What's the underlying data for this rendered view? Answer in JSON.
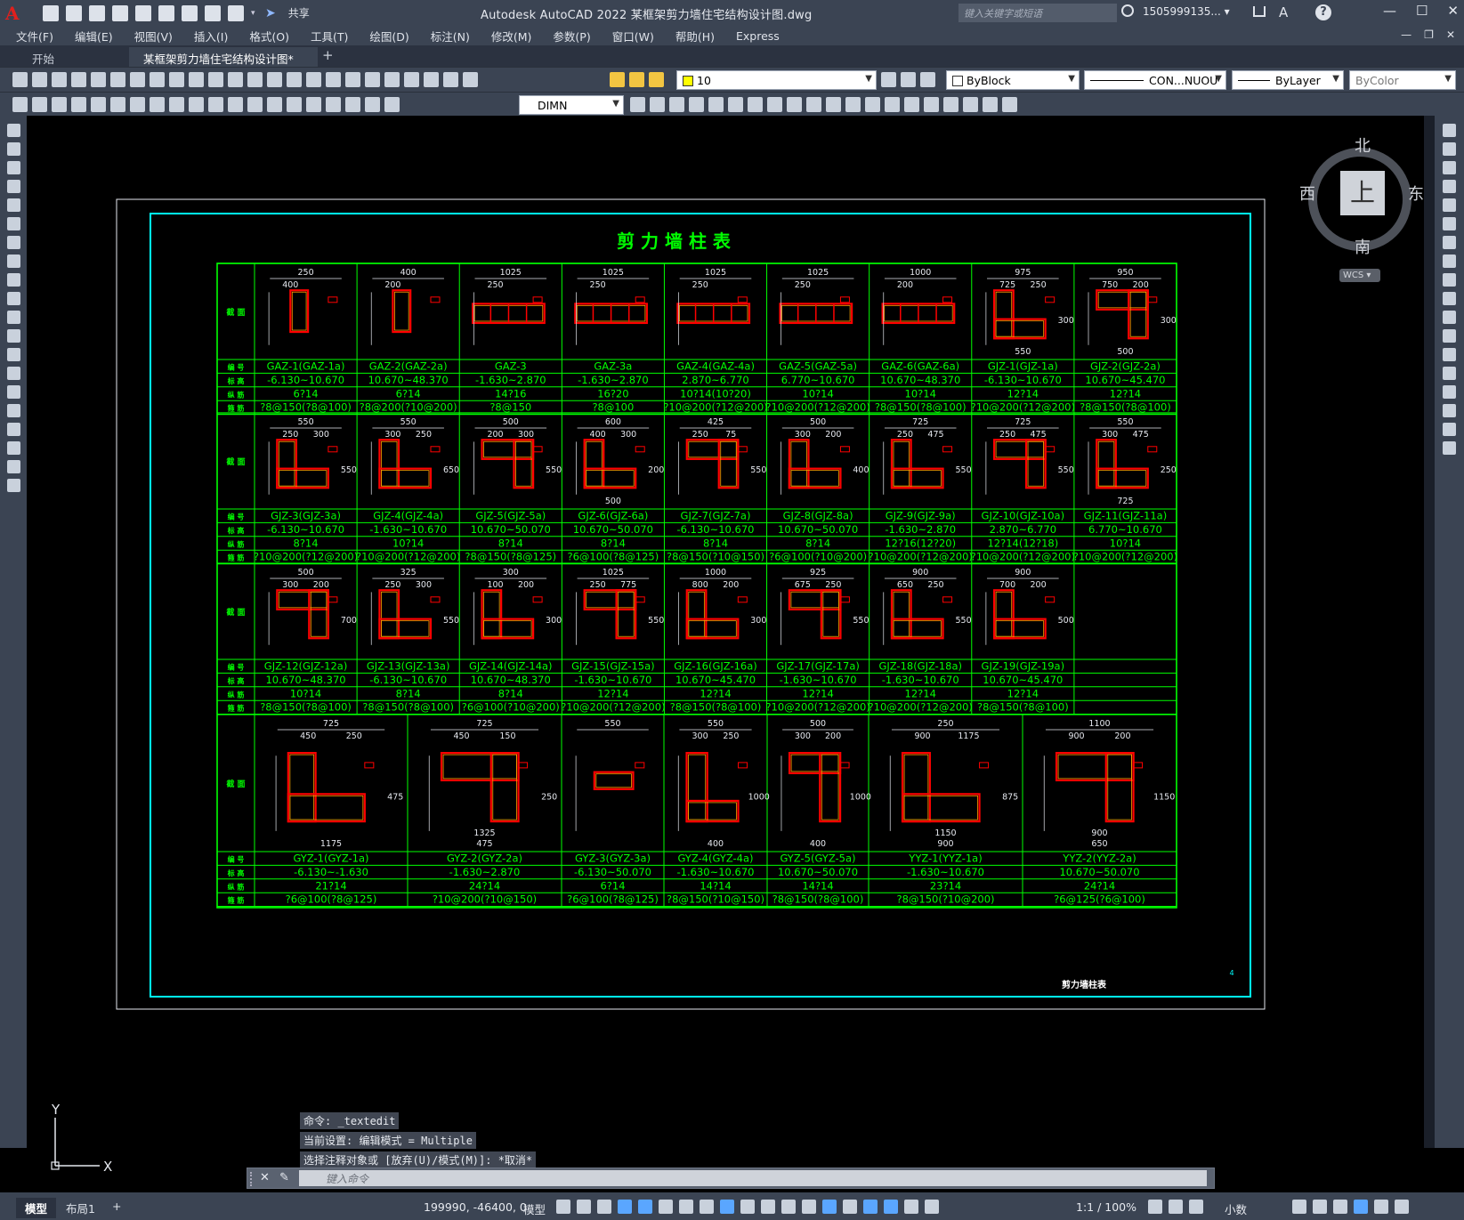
{
  "app": {
    "logo": "A",
    "window_title": "Autodesk AutoCAD 2022    某框架剪力墙住宅结构设计图.dwg",
    "share_label": "共享",
    "search_placeholder": "键入关键字或短语",
    "user": "1505999135... ▾",
    "help": "?"
  },
  "menu": {
    "items": [
      "文件(F)",
      "编辑(E)",
      "视图(V)",
      "插入(I)",
      "格式(O)",
      "工具(T)",
      "绘图(D)",
      "标注(N)",
      "修改(M)",
      "参数(P)",
      "窗口(W)",
      "帮助(H)",
      "Express"
    ]
  },
  "tabs": {
    "start": "开始",
    "drawing": "某框架剪力墙住宅结构设计图*",
    "close": "×"
  },
  "toolbar": {
    "layer_value": "10",
    "color_value": "ByBlock",
    "linetype_value": "CON...NUOU",
    "lineweight_value": "ByLayer",
    "plotstyle_value": "ByColor",
    "dimstyle_value": "DIMN"
  },
  "viewcube": {
    "north": "北",
    "south": "南",
    "west": "西",
    "east": "东",
    "top": "上",
    "wcs": "WCS ▾"
  },
  "ucs": {
    "x": "X",
    "y": "Y"
  },
  "drawing": {
    "title": "剪 力 墙 柱 表",
    "footer_title": "剪力墙柱表",
    "page_no": "4",
    "row_labels": {
      "section": "截 面",
      "id": "编 号",
      "elev": "标 高",
      "rebar": "纵 筋",
      "hoop": "箍 筋",
      "hoop2": "箍 筋"
    },
    "block1": {
      "ids": [
        "GAZ-1(GAZ-1a)",
        "GAZ-2(GAZ-2a)",
        "GAZ-3",
        "GAZ-3a",
        "GAZ-4(GAZ-4a)",
        "GAZ-5(GAZ-5a)",
        "GAZ-6(GAZ-6a)",
        "GJZ-1(GJZ-1a)",
        "GJZ-2(GJZ-2a)"
      ],
      "elevs": [
        "-6.130~10.670",
        "10.670~48.370",
        "-1.630~2.870",
        "-1.630~2.870",
        "2.870~6.770",
        "6.770~10.670",
        "10.670~48.370",
        "-6.130~10.670",
        "10.670~45.470"
      ],
      "rebars": [
        "6?14",
        "6?14",
        "14?16",
        "16?20",
        "10?14(10?20)",
        "10?14",
        "10?14",
        "12?14",
        "12?14"
      ],
      "hoops": [
        "?8@150(?8@100)",
        "?8@200(?10@200)",
        "?8@150",
        "?8@100",
        "?10@200(?12@200)",
        "?10@200(?12@200)",
        "?8@150(?8@100)",
        "?10@200(?12@200)",
        "?8@150(?8@100)"
      ],
      "dims": [
        [
          "250",
          "400"
        ],
        [
          "400",
          "200"
        ],
        [
          "1025",
          "250"
        ],
        [
          "1025",
          "250"
        ],
        [
          "1025",
          "250"
        ],
        [
          "1025",
          "250"
        ],
        [
          "1000",
          "200"
        ],
        [
          "975",
          "725",
          "250",
          "300",
          "550"
        ],
        [
          "950",
          "750",
          "200",
          "300",
          "500"
        ]
      ]
    },
    "block2": {
      "ids": [
        "GJZ-3(GJZ-3a)",
        "GJZ-4(GJZ-4a)",
        "GJZ-5(GJZ-5a)",
        "GJZ-6(GJZ-6a)",
        "GJZ-7(GJZ-7a)",
        "GJZ-8(GJZ-8a)",
        "GJZ-9(GJZ-9a)",
        "GJZ-10(GJZ-10a)",
        "GJZ-11(GJZ-11a)"
      ],
      "elevs": [
        "-6.130~10.670",
        "-1.630~10.670",
        "10.670~50.070",
        "10.670~50.070",
        "-6.130~10.670",
        "10.670~50.070",
        "-1.630~2.870",
        "2.870~6.770",
        "6.770~10.670"
      ],
      "rebars": [
        "8?14",
        "10?14",
        "8?14",
        "8?14",
        "8?14",
        "8?14",
        "12?16(12?20)",
        "12?14(12?18)",
        "10?14"
      ],
      "hoops": [
        "?10@200(?12@200)",
        "?10@200(?12@200)",
        "?8@150(?8@125)",
        "?6@100(?8@125)",
        "?8@150(?10@150)",
        "?6@100(?10@200)",
        "?10@200(?12@200)",
        "?10@200(?12@200)",
        "?10@200(?12@200)"
      ],
      "dims": [
        [
          "550",
          "250",
          "300",
          "550"
        ],
        [
          "550",
          "300",
          "250",
          "650"
        ],
        [
          "500",
          "200",
          "300",
          "550"
        ],
        [
          "600",
          "400",
          "300",
          "200",
          "500"
        ],
        [
          "425",
          "250",
          "75",
          "550"
        ],
        [
          "500",
          "300",
          "200",
          "400"
        ],
        [
          "725",
          "250",
          "475",
          "550"
        ],
        [
          "725",
          "250",
          "475",
          "550"
        ],
        [
          "550",
          "300",
          "475",
          "250",
          "725"
        ]
      ]
    },
    "block3": {
      "ids": [
        "GJZ-12(GJZ-12a)",
        "GJZ-13(GJZ-13a)",
        "GJZ-14(GJZ-14a)",
        "GJZ-15(GJZ-15a)",
        "GJZ-16(GJZ-16a)",
        "GJZ-17(GJZ-17a)",
        "GJZ-18(GJZ-18a)",
        "GJZ-19(GJZ-19a)",
        ""
      ],
      "elevs": [
        "10.670~48.370",
        "-6.130~10.670",
        "10.670~48.370",
        "-1.630~10.670",
        "10.670~45.470",
        "-1.630~10.670",
        "-1.630~10.670",
        "10.670~45.470",
        ""
      ],
      "rebars": [
        "10?14",
        "8?14",
        "8?14",
        "12?14",
        "12?14",
        "12?14",
        "12?14",
        "12?14",
        ""
      ],
      "hoops": [
        "?8@150(?8@100)",
        "?8@150(?8@100)",
        "?6@100(?10@200)",
        "?10@200(?12@200)",
        "?8@150(?8@100)",
        "?10@200(?12@200)",
        "?10@200(?12@200)",
        "?8@150(?8@100)",
        ""
      ],
      "dims": [
        [
          "500",
          "300",
          "200",
          "700"
        ],
        [
          "325",
          "250",
          "300",
          "550"
        ],
        [
          "300",
          "100",
          "200",
          "300"
        ],
        [
          "1025",
          "250",
          "775",
          "550"
        ],
        [
          "1000",
          "800",
          "200",
          "300"
        ],
        [
          "925",
          "675",
          "250",
          "550"
        ],
        [
          "900",
          "650",
          "250",
          "550"
        ],
        [
          "900",
          "700",
          "200",
          "500"
        ],
        []
      ]
    },
    "block4": {
      "ids": [
        "GYZ-1(GYZ-1a)",
        "GYZ-2(GYZ-2a)",
        "GYZ-3(GYZ-3a)",
        "GYZ-4(GYZ-4a)",
        "GYZ-5(GYZ-5a)",
        "YYZ-1(YYZ-1a)",
        "YYZ-2(YYZ-2a)"
      ],
      "elevs": [
        "-6.130~-1.630",
        "-1.630~2.870",
        "-6.130~50.070",
        "-1.630~10.670",
        "10.670~50.070",
        "-1.630~10.670",
        "10.670~50.070"
      ],
      "rebars": [
        "21?14",
        "24?14",
        "6?14",
        "14?14",
        "14?14",
        "23?14",
        "24?14"
      ],
      "hoops": [
        "?6@100(?8@125)",
        "?10@200(?10@150)",
        "?6@100(?8@125)",
        "?8@150(?10@150)",
        "?8@150(?8@100)",
        "?8@150(?10@200)",
        "?6@125(?6@100)"
      ],
      "dims": [
        [
          "725",
          "450",
          "250",
          "475",
          "1175"
        ],
        [
          "725",
          "450",
          "150",
          "250",
          "475",
          "1325"
        ],
        [
          "550"
        ],
        [
          "550",
          "300",
          "250",
          "1000",
          "400"
        ],
        [
          "500",
          "300",
          "200",
          "1000",
          "400"
        ],
        [
          "250",
          "900",
          "1175",
          "875",
          "900",
          "1150"
        ],
        [
          "1100",
          "900",
          "200",
          "1150",
          "650",
          "900"
        ]
      ]
    }
  },
  "command": {
    "history": [
      "命令: _textedit",
      "当前设置: 编辑模式 = Multiple",
      "选择注释对象或 [放弃(U)/模式(M)]: *取消*"
    ],
    "placeholder": "键入命令"
  },
  "status": {
    "model_tab": "模型",
    "layout_tab": "布局1",
    "add_layout": "+",
    "coords": "199990, -46400, 0",
    "model": "模型",
    "scale": "1:1 / 100%",
    "units": "小数"
  },
  "colors": {
    "ui_bg": "#3b4453",
    "table_line": "#00ff00",
    "frame": "#00ffff",
    "column_section": "#ff0000",
    "text": "#00ff00"
  }
}
